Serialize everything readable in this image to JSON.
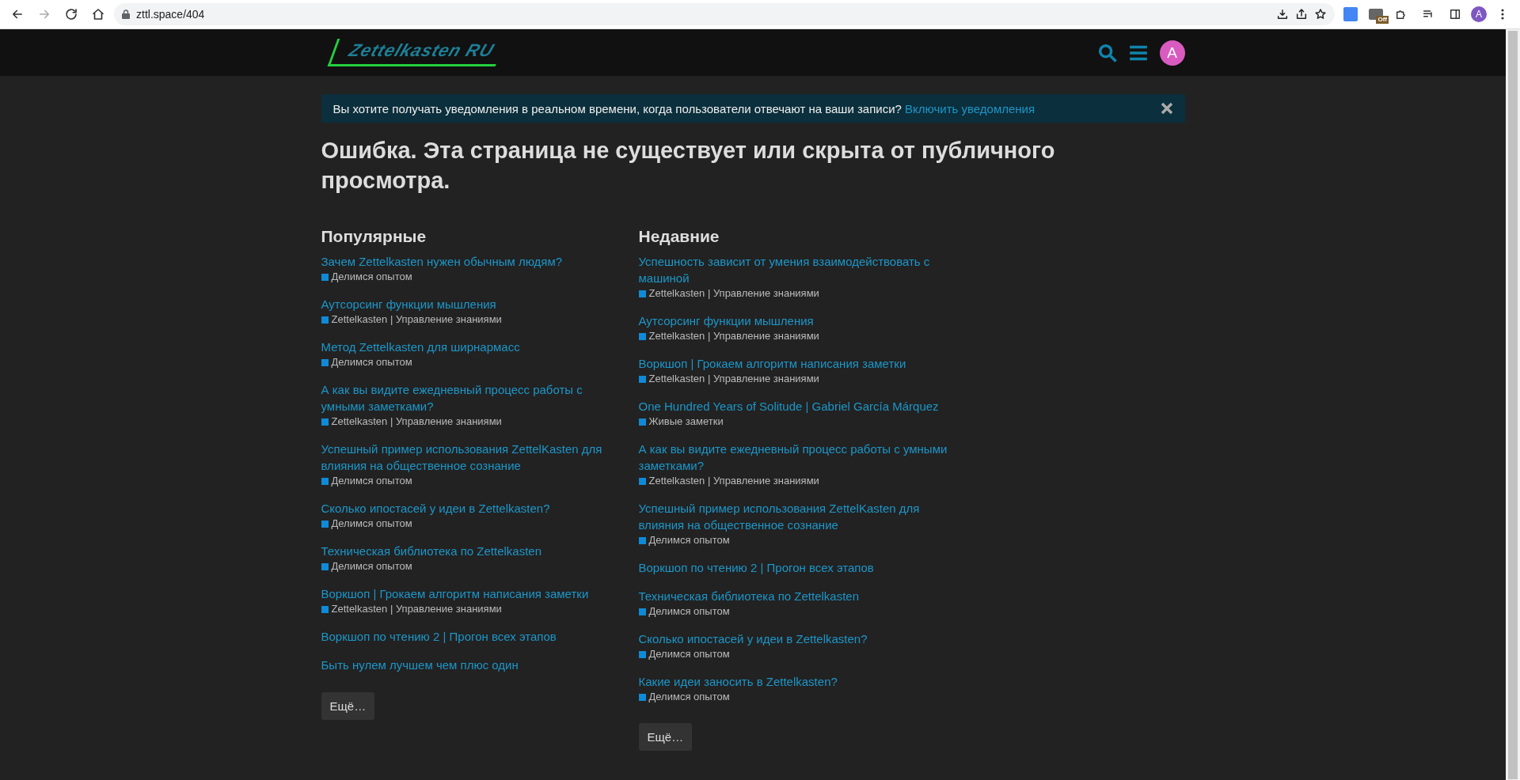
{
  "browser": {
    "url": "zttl.space/404",
    "forward_disabled": true,
    "extension_badge": "Off",
    "profile_initial": "A"
  },
  "header": {
    "logo": "Zettelkasten RU",
    "avatar_initial": "A"
  },
  "notice": {
    "text": "Вы хотите получать уведомления в реальном времени, когда пользователи отвечают на ваши записи?",
    "link": "Включить уведомления"
  },
  "title": "Ошибка. Эта страница не существует или скрыта от публичного просмотра.",
  "columns": [
    {
      "heading": "Популярные",
      "topics": [
        {
          "title": "Зачем Zettelkasten нужен обычным людям?",
          "category": "Делимся опытом"
        },
        {
          "title": "Аутсорсинг функции мышления",
          "category": "Zettelkasten | Управление знаниями"
        },
        {
          "title": "Метод Zettelkasten для ширнармасс",
          "category": "Делимся опытом"
        },
        {
          "title": "А как вы видите ежедневный процесс работы с умными заметками?",
          "category": "Zettelkasten | Управление знаниями"
        },
        {
          "title": "Успешный пример использования ZettelKasten для влияния на общественное сознание",
          "category": "Делимся опытом"
        },
        {
          "title": "Сколько ипостасей у идеи в Zettelkasten?",
          "category": "Делимся опытом"
        },
        {
          "title": "Техническая библиотека по Zettelkasten",
          "category": "Делимся опытом"
        },
        {
          "title": "Воркшоп | Грокаем алгоритм написания заметки",
          "category": "Zettelkasten | Управление знаниями"
        },
        {
          "title": "Воркшоп по чтению 2 | Прогон всех этапов"
        },
        {
          "title": "Быть нулем лучшем чем плюс один"
        }
      ],
      "more": "Ещё…"
    },
    {
      "heading": "Недавние",
      "topics": [
        {
          "title": "Успешность зависит от умения взаимодействовать с машиной",
          "category": "Zettelkasten | Управление знаниями"
        },
        {
          "title": "Аутсорсинг функции мышления",
          "category": "Zettelkasten | Управление знаниями"
        },
        {
          "title": "Воркшоп | Грокаем алгоритм написания заметки",
          "category": "Zettelkasten | Управление знаниями"
        },
        {
          "title": "One Hundred Years of Solitude | Gabriel García Márquez",
          "category": "Живые заметки"
        },
        {
          "title": "А как вы видите ежедневный процесс работы с умными заметками?",
          "category": "Zettelkasten | Управление знаниями"
        },
        {
          "title": "Успешный пример использования ZettelKasten для влияния на общественное сознание",
          "category": "Делимся опытом"
        },
        {
          "title": "Воркшоп по чтению 2 | Прогон всех этапов"
        },
        {
          "title": "Техническая библиотека по Zettelkasten",
          "category": "Делимся опытом"
        },
        {
          "title": "Сколько ипостасей у идеи в Zettelkasten?",
          "category": "Делимся опытом"
        },
        {
          "title": "Какие идеи заносить в Zettelkasten?",
          "category": "Делимся опытом"
        }
      ],
      "more": "Ещё…"
    }
  ]
}
